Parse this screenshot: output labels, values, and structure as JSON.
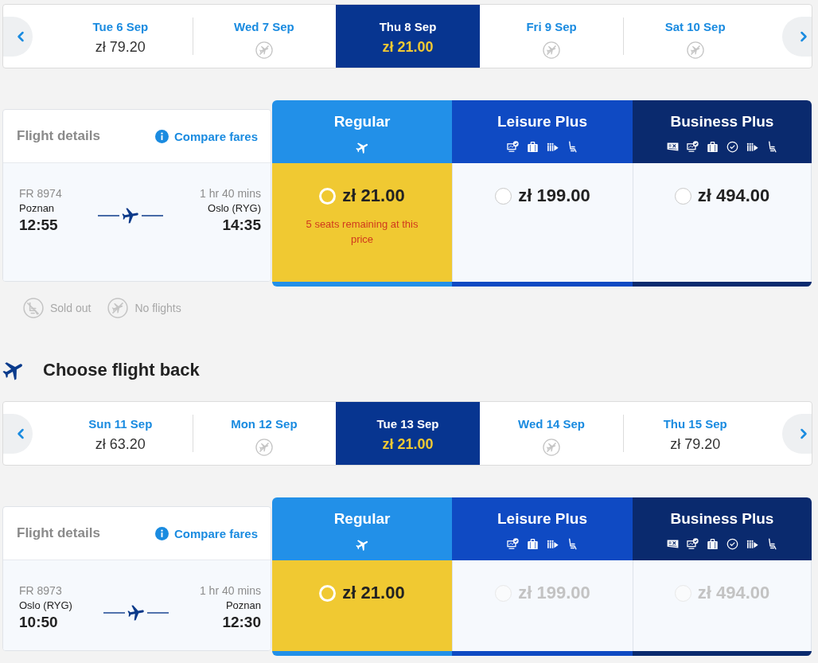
{
  "outbound": {
    "days": [
      {
        "kind": "fare",
        "label": "Tue 6 Sep",
        "price": "zł 79.20",
        "selected": false
      },
      {
        "kind": "no_flights",
        "label": "Wed 7 Sep",
        "selected": false
      },
      {
        "kind": "fare",
        "label": "Thu 8 Sep",
        "price": "zł 21.00",
        "selected": true
      },
      {
        "kind": "no_flights",
        "label": "Fri 9 Sep",
        "selected": false
      },
      {
        "kind": "no_flights",
        "label": "Sat 10 Sep",
        "selected": false
      }
    ],
    "details": {
      "title": "Flight details",
      "link": "Compare fares"
    },
    "flight": {
      "number": "FR 8974",
      "from": "Poznan",
      "departs": "12:55",
      "duration": "1 hr 40 mins",
      "to": "Oslo (RYG)",
      "arrives": "14:35"
    },
    "fares": [
      {
        "kind": "regular",
        "name": "Regular",
        "price": "zł 21.00",
        "selected": true,
        "disabled": false,
        "note": "5 seats remaining at this price"
      },
      {
        "kind": "leisure",
        "name": "Leisure Plus",
        "price": "zł 199.00",
        "selected": false,
        "disabled": false
      },
      {
        "kind": "business",
        "name": "Business Plus",
        "price": "zł 494.00",
        "selected": false,
        "disabled": false
      }
    ]
  },
  "legend": [
    {
      "kind": "sold_out",
      "label": "Sold out"
    },
    {
      "kind": "no_flights",
      "label": "No flights"
    }
  ],
  "return": {
    "heading": "Choose flight back",
    "days": [
      {
        "kind": "fare",
        "label": "Sun 11 Sep",
        "price": "zł 63.20",
        "selected": false
      },
      {
        "kind": "no_flights",
        "label": "Mon 12 Sep",
        "selected": false
      },
      {
        "kind": "fare",
        "label": "Tue 13 Sep",
        "price": "zł 21.00",
        "selected": true
      },
      {
        "kind": "no_flights",
        "label": "Wed 14 Sep",
        "selected": false
      },
      {
        "kind": "fare",
        "label": "Thu 15 Sep",
        "price": "zł 79.20",
        "selected": false
      }
    ],
    "details": {
      "title": "Flight details",
      "link": "Compare fares"
    },
    "flight": {
      "number": "FR 8973",
      "from": "Oslo (RYG)",
      "departs": "10:50",
      "duration": "1 hr 40 mins",
      "to": "Poznan",
      "arrives": "12:30"
    },
    "fares": [
      {
        "kind": "regular",
        "name": "Regular",
        "price": "zł 21.00",
        "selected": true,
        "disabled": false
      },
      {
        "kind": "leisure",
        "name": "Leisure Plus",
        "price": "zł 199.00",
        "selected": false,
        "disabled": true
      },
      {
        "kind": "business",
        "name": "Business Plus",
        "price": "zł 494.00",
        "selected": false,
        "disabled": true
      }
    ]
  }
}
